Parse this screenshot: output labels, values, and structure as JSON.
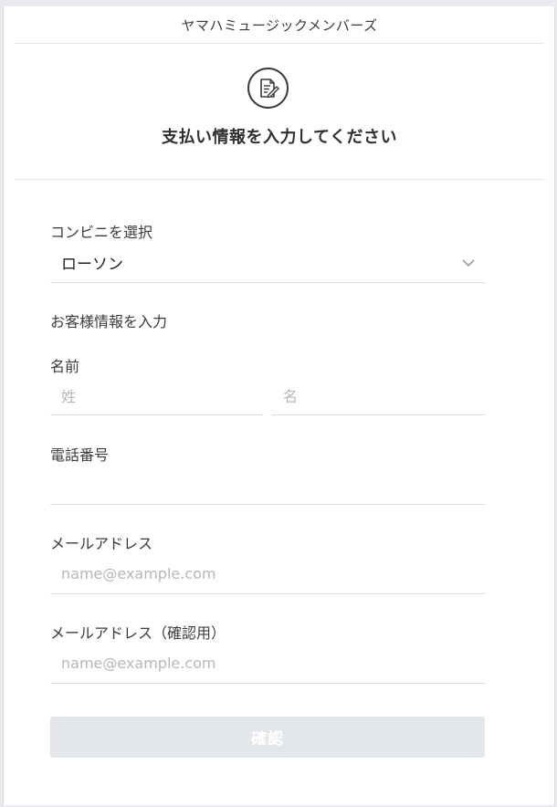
{
  "brand": {
    "title": "ヤマハミュージックメンバーズ"
  },
  "page": {
    "icon": "document-edit-icon",
    "heading": "支払い情報を入力してください"
  },
  "store_select": {
    "label": "コンビニを選択",
    "selected_value": "ローソン",
    "icon": "chevron-down-icon"
  },
  "customer_section": {
    "title": "お客様情報を入力"
  },
  "name": {
    "label": "名前",
    "last_placeholder": "姓",
    "first_placeholder": "名"
  },
  "phone": {
    "label": "電話番号",
    "value": ""
  },
  "email": {
    "label": "メールアドレス",
    "placeholder": "name@example.com"
  },
  "email_confirm": {
    "label": "メールアドレス（確認用）",
    "placeholder": "name@example.com"
  },
  "confirm_button": {
    "label": "確認"
  },
  "colors": {
    "button_disabled_bg": "#e3e6ea",
    "text_primary": "#2f3033",
    "placeholder": "#b4b7bd"
  }
}
